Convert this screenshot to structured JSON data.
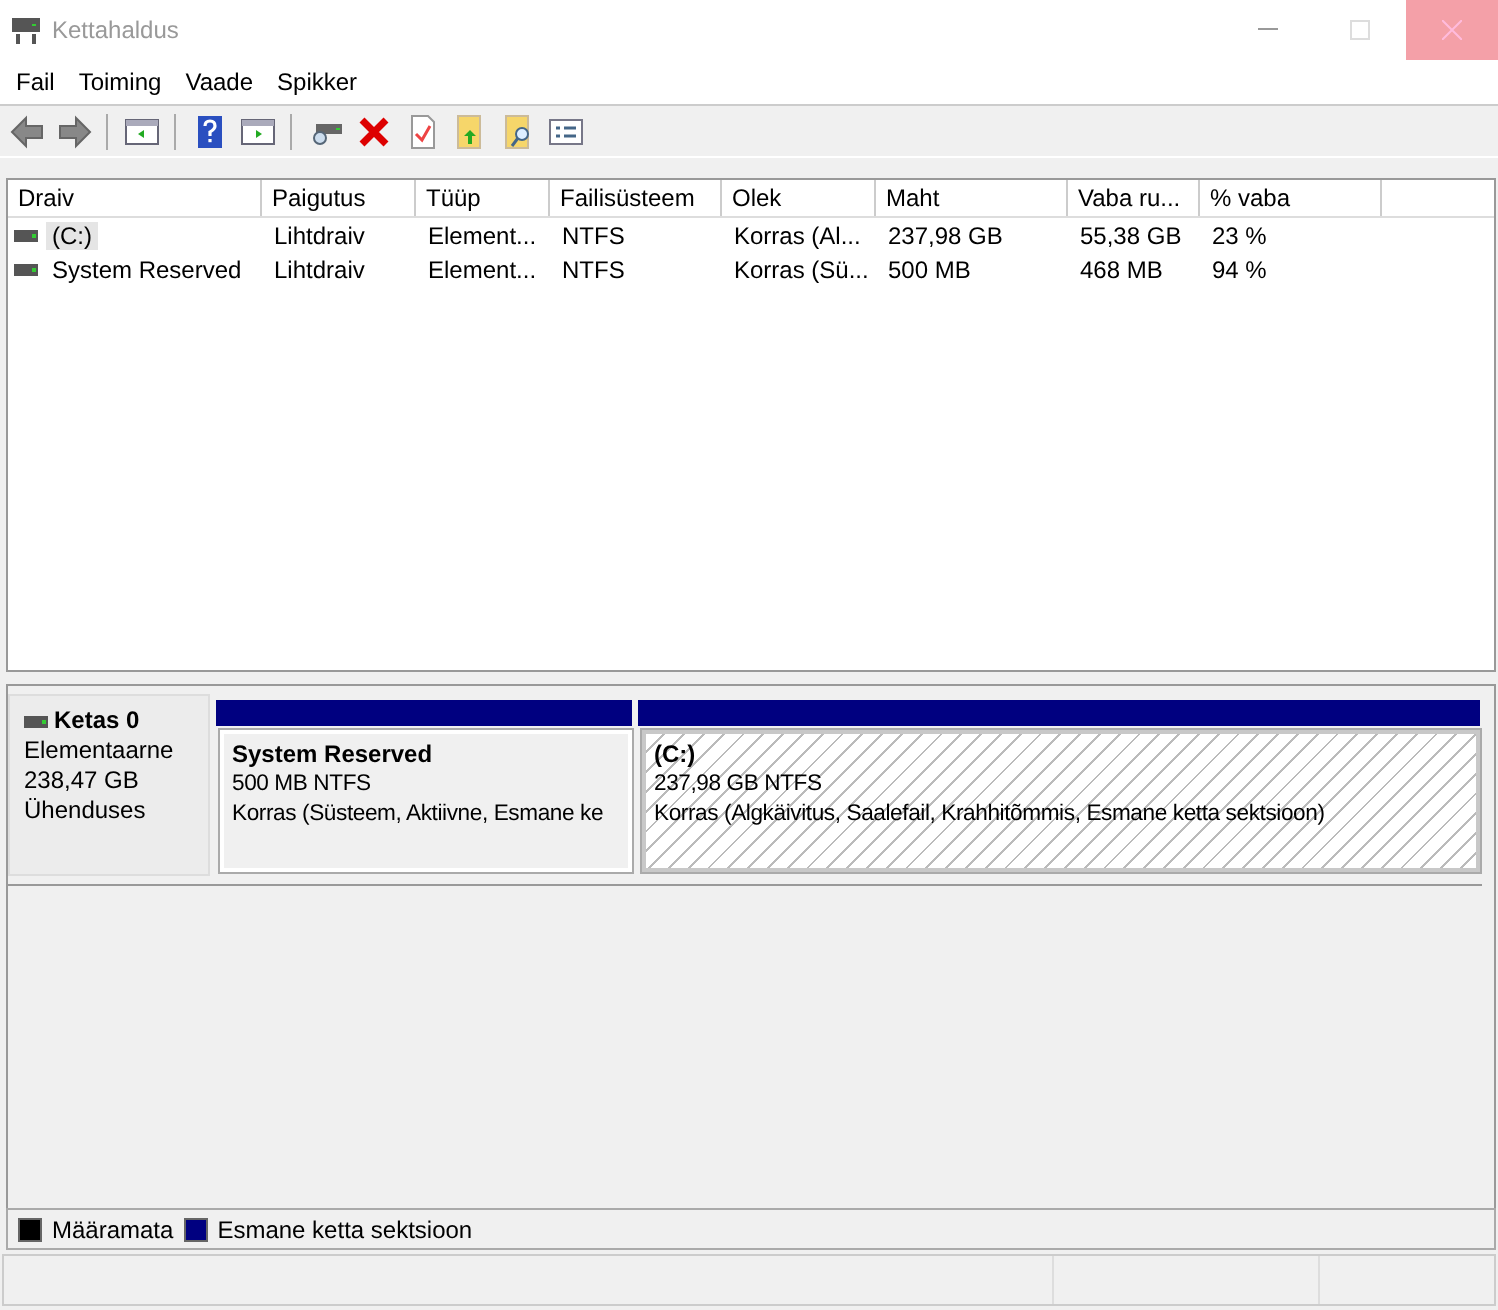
{
  "window": {
    "title": "Kettahaldus"
  },
  "menu": [
    "Fail",
    "Toiming",
    "Vaade",
    "Spikker"
  ],
  "volumes": {
    "columns": [
      "Draiv",
      "Paigutus",
      "Tüüp",
      "Failisüsteem",
      "Olek",
      "Maht",
      "Vaba ru...",
      "% vaba"
    ],
    "rows": [
      {
        "selected": true,
        "cells": [
          "(C:)",
          "Lihtdraiv",
          "Element...",
          "NTFS",
          "Korras (Al...",
          "237,98 GB",
          "55,38 GB",
          "23 %"
        ]
      },
      {
        "selected": false,
        "cells": [
          "System Reserved",
          "Lihtdraiv",
          "Element...",
          "NTFS",
          "Korras (Sü...",
          "500 MB",
          "468 MB",
          "94 %"
        ]
      }
    ]
  },
  "disks": [
    {
      "name": "Ketas 0",
      "type": "Elementaarne",
      "size": "238,47 GB",
      "status": "Ühenduses",
      "partitions": [
        {
          "name": "System Reserved",
          "size": "500 MB NTFS",
          "status": "Korras (Süsteem, Aktiivne, Esmane ke",
          "selected": false,
          "color": "#000080"
        },
        {
          "name": "(C:)",
          "size": "237,98 GB NTFS",
          "status": "Korras (Algkäivitus, Saalefail, Krahhitõmmis, Esmane ketta sektsioon)",
          "selected": true,
          "color": "#000080"
        }
      ]
    }
  ],
  "legend": [
    {
      "label": "Määramata",
      "color": "#000000"
    },
    {
      "label": "Esmane ketta sektsioon",
      "color": "#000080"
    }
  ]
}
